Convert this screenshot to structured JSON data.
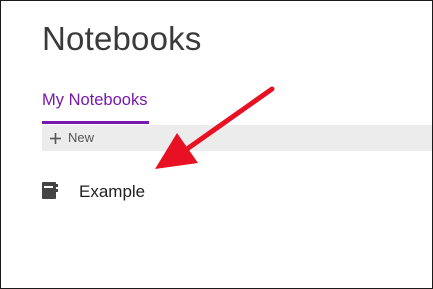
{
  "header": {
    "title": "Notebooks"
  },
  "tabs": [
    {
      "label": "My Notebooks",
      "selected": true
    }
  ],
  "toolbar": {
    "new_label": "New",
    "new_icon": "plus-icon"
  },
  "notebooks": [
    {
      "label": "Example",
      "icon": "notebook-icon"
    }
  ],
  "annotation": {
    "arrow_icon": "pointer-arrow-icon",
    "arrow_color": "#e81123"
  },
  "colors": {
    "accent": "#7719aa",
    "toolbar_background": "#ececec",
    "title_text": "#3a3a3a"
  }
}
